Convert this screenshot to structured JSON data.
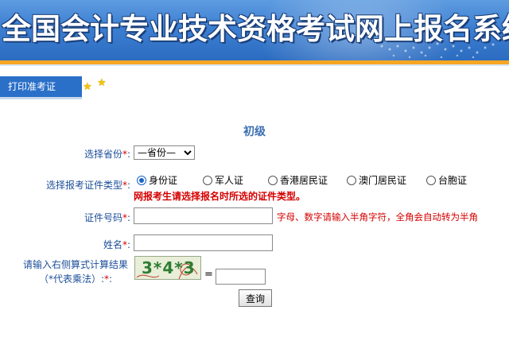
{
  "header": {
    "title": "全国会计专业技术资格考试网上报名系统"
  },
  "toolbar": {
    "print_tab_label": "打印准考证",
    "star_icons": [
      "star-icon",
      "star-icon"
    ]
  },
  "form": {
    "level_title": "初级",
    "province": {
      "label": "选择省份",
      "selected": "—省份—"
    },
    "id_type": {
      "label": "选择报考证件类型",
      "options": [
        "身份证",
        "军人证",
        "香港居民证",
        "澳门居民证",
        "台胞证"
      ],
      "selected_index": 0,
      "warning": "网报考生请选择报名时所选的证件类型。"
    },
    "id_number": {
      "label": "证件号码",
      "value": "",
      "hint": "字母、数字请输入半角字符，全角会自动转为半角"
    },
    "name": {
      "label": "姓名",
      "value": ""
    },
    "captcha": {
      "label_line1": "请输入右侧算式计算结果",
      "label_line2": "（*代表乘法）",
      "expression": "3*4*3",
      "equals": "=",
      "answer": ""
    },
    "submit_label": "查询"
  },
  "colors": {
    "banner_blue": "#3c7fd2",
    "tab_blue": "#2a6fc8",
    "label_blue": "#1d4f99",
    "warning_red": "#d40000",
    "accent_orange": "#f5a623"
  }
}
